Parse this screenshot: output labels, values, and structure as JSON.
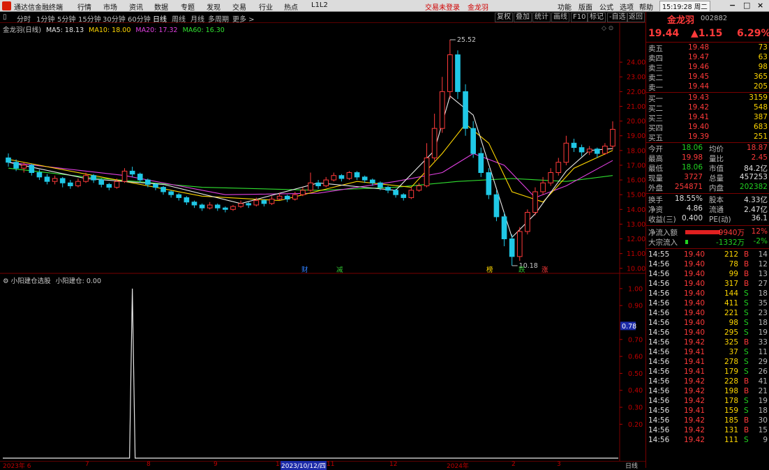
{
  "app": {
    "name": "通达信金融终端",
    "menu": [
      "行情",
      "市场",
      "资讯",
      "数据",
      "专题",
      "发现",
      "交易",
      "行业",
      "热点",
      "L1L2"
    ],
    "login_status": "交易未登录",
    "stock_tab": "金龙羽",
    "right_menu": [
      "功能",
      "版面",
      "公式",
      "选项",
      "帮助"
    ],
    "clock": "15:19:28",
    "weekday": "周二",
    "window_buttons": [
      "−",
      "□",
      "×"
    ]
  },
  "toolbar": {
    "periods": [
      "分时",
      "1分钟",
      "5分钟",
      "15分钟",
      "30分钟",
      "60分钟",
      "日线",
      "周线",
      "月线",
      "多周期",
      "更多 >"
    ],
    "active_period": "日线",
    "right_buttons": [
      "复权",
      "叠加",
      "统计",
      "画线",
      "F10",
      "标记",
      "-自选",
      "返回"
    ]
  },
  "main_legend": {
    "stock": "金龙羽(日线)",
    "ma5": "MA5: 18.13",
    "ma10": "MA10: 18.00",
    "ma20": "MA20: 17.32",
    "ma60": "MA60: 16.30"
  },
  "chart_data": {
    "type": "candlestick",
    "y_ticks": [
      "24.00",
      "23.00",
      "22.00",
      "21.00",
      "20.00",
      "19.00",
      "18.00",
      "17.00",
      "16.00",
      "15.00",
      "14.00",
      "13.00",
      "12.00",
      "11.00",
      "10.00"
    ],
    "ylim": [
      9.8,
      25.9
    ],
    "high_label": "25.52",
    "low_label": "10.18",
    "markers": [
      "财",
      "减",
      "榜",
      "跌",
      "涨"
    ],
    "candles": [
      [
        0,
        17.5,
        17.2,
        17.8,
        16.9
      ],
      [
        1,
        17.2,
        16.8,
        17.4,
        16.6
      ],
      [
        2,
        16.8,
        17.0,
        17.2,
        16.5
      ],
      [
        3,
        17.0,
        16.5,
        17.1,
        16.3
      ],
      [
        4,
        16.5,
        16.2,
        16.7,
        16.0
      ],
      [
        5,
        16.2,
        15.9,
        16.4,
        15.7
      ],
      [
        6,
        15.9,
        16.1,
        16.3,
        15.7
      ],
      [
        7,
        16.1,
        15.8,
        16.2,
        15.5
      ],
      [
        8,
        15.8,
        15.6,
        16.0,
        15.4
      ],
      [
        9,
        15.6,
        15.9,
        16.1,
        15.5
      ],
      [
        10,
        15.9,
        16.3,
        16.5,
        15.8
      ],
      [
        11,
        16.3,
        16.0,
        16.4,
        15.8
      ],
      [
        12,
        16.0,
        15.7,
        16.1,
        15.5
      ],
      [
        13,
        15.7,
        15.5,
        15.8,
        15.3
      ],
      [
        14,
        15.5,
        15.9,
        16.1,
        15.4
      ],
      [
        15,
        15.9,
        16.6,
        16.8,
        15.8
      ],
      [
        16,
        16.6,
        16.4,
        16.9,
        16.2
      ],
      [
        17,
        16.4,
        16.0,
        16.5,
        15.8
      ],
      [
        18,
        16.0,
        15.7,
        16.1,
        15.5
      ],
      [
        19,
        15.7,
        15.5,
        15.8,
        15.3
      ],
      [
        20,
        15.5,
        15.2,
        15.6,
        15.0
      ],
      [
        21,
        15.2,
        15.0,
        15.3,
        14.8
      ],
      [
        22,
        15.0,
        14.8,
        15.1,
        14.6
      ],
      [
        23,
        14.8,
        14.5,
        14.9,
        14.3
      ],
      [
        24,
        14.5,
        14.3,
        14.6,
        14.1
      ],
      [
        25,
        14.3,
        14.1,
        14.4,
        13.9
      ],
      [
        26,
        14.1,
        14.3,
        14.5,
        14.0
      ],
      [
        27,
        14.3,
        14.1,
        14.4,
        13.9
      ],
      [
        28,
        14.1,
        14.0,
        14.2,
        13.8
      ],
      [
        29,
        14.0,
        14.2,
        14.3,
        13.9
      ],
      [
        30,
        14.2,
        14.4,
        14.6,
        14.1
      ],
      [
        31,
        14.4,
        14.3,
        14.5,
        14.1
      ],
      [
        32,
        14.3,
        14.6,
        14.8,
        14.2
      ],
      [
        33,
        14.6,
        14.4,
        14.7,
        14.2
      ],
      [
        34,
        14.4,
        14.7,
        14.9,
        14.3
      ],
      [
        35,
        14.7,
        14.9,
        15.1,
        14.6
      ],
      [
        36,
        14.9,
        14.7,
        15.0,
        14.5
      ],
      [
        37,
        14.7,
        15.0,
        15.2,
        14.6
      ],
      [
        38,
        15.0,
        15.3,
        15.5,
        14.9
      ],
      [
        39,
        15.3,
        15.8,
        16.5,
        15.2
      ],
      [
        40,
        15.8,
        15.6,
        16.0,
        15.4
      ],
      [
        41,
        15.6,
        16.0,
        16.2,
        15.5
      ],
      [
        42,
        16.0,
        16.3,
        16.5,
        15.9
      ],
      [
        43,
        16.3,
        16.1,
        16.4,
        15.9
      ],
      [
        44,
        16.1,
        16.5,
        16.6,
        16.0
      ],
      [
        45,
        16.5,
        16.2,
        16.6,
        16.0
      ],
      [
        46,
        16.2,
        16.0,
        16.3,
        15.8
      ],
      [
        47,
        16.0,
        15.8,
        16.1,
        15.6
      ],
      [
        48,
        15.8,
        15.5,
        15.9,
        15.3
      ],
      [
        49,
        15.5,
        15.3,
        15.6,
        15.1
      ],
      [
        50,
        15.3,
        15.0,
        15.4,
        14.8
      ],
      [
        51,
        15.0,
        14.8,
        15.1,
        14.6
      ],
      [
        52,
        14.8,
        15.3,
        15.5,
        14.7
      ],
      [
        53,
        15.3,
        15.6,
        15.8,
        15.2
      ],
      [
        54,
        15.6,
        17.5,
        18.5,
        15.5
      ],
      [
        55,
        17.5,
        19.5,
        20.5,
        17.3
      ],
      [
        56,
        19.5,
        22.0,
        23.0,
        19.2
      ],
      [
        57,
        22.0,
        24.5,
        25.52,
        21.5
      ],
      [
        58,
        24.5,
        22.0,
        24.8,
        21.5
      ],
      [
        59,
        22.0,
        19.5,
        22.5,
        19.0
      ],
      [
        60,
        19.5,
        17.8,
        20.0,
        17.5
      ],
      [
        61,
        17.8,
        16.5,
        18.2,
        16.2
      ],
      [
        62,
        16.5,
        15.0,
        16.8,
        14.7
      ],
      [
        63,
        15.0,
        13.5,
        15.3,
        13.2
      ],
      [
        64,
        13.5,
        12.0,
        13.8,
        11.5
      ],
      [
        65,
        12.0,
        10.8,
        12.3,
        10.18
      ],
      [
        66,
        10.8,
        12.5,
        12.8,
        10.5
      ],
      [
        67,
        12.5,
        13.8,
        14.0,
        12.3
      ],
      [
        68,
        13.8,
        15.2,
        15.5,
        13.6
      ],
      [
        69,
        15.2,
        15.8,
        16.2,
        15.0
      ],
      [
        70,
        15.8,
        16.5,
        16.8,
        15.6
      ],
      [
        71,
        16.5,
        17.2,
        17.5,
        16.3
      ],
      [
        72,
        17.2,
        18.5,
        19.0,
        17.0
      ],
      [
        73,
        18.5,
        18.2,
        18.8,
        17.9
      ],
      [
        74,
        18.2,
        17.9,
        18.4,
        17.6
      ],
      [
        75,
        17.9,
        18.1,
        18.3,
        17.7
      ],
      [
        76,
        18.1,
        17.8,
        18.2,
        17.5
      ],
      [
        77,
        17.8,
        18.3,
        18.5,
        17.7
      ],
      [
        78,
        18.3,
        19.44,
        19.98,
        18.06
      ]
    ],
    "ma5": [
      [
        0,
        17.2
      ],
      [
        10,
        16.1
      ],
      [
        20,
        15.7
      ],
      [
        30,
        14.4
      ],
      [
        40,
        15.8
      ],
      [
        50,
        15.3
      ],
      [
        55,
        18.0
      ],
      [
        57,
        21.7
      ],
      [
        60,
        20.4
      ],
      [
        63,
        15.4
      ],
      [
        65,
        12.1
      ],
      [
        68,
        13.7
      ],
      [
        72,
        16.6
      ],
      [
        75,
        18.0
      ],
      [
        78,
        18.13
      ]
    ],
    "ma10": [
      [
        0,
        17.4
      ],
      [
        12,
        16.2
      ],
      [
        25,
        14.9
      ],
      [
        35,
        14.6
      ],
      [
        45,
        15.9
      ],
      [
        52,
        15.5
      ],
      [
        56,
        17.8
      ],
      [
        59,
        19.8
      ],
      [
        62,
        18.5
      ],
      [
        65,
        15.2
      ],
      [
        69,
        14.5
      ],
      [
        73,
        16.8
      ],
      [
        78,
        18.0
      ]
    ],
    "ma20": [
      [
        0,
        17.2
      ],
      [
        15,
        16.3
      ],
      [
        28,
        15.0
      ],
      [
        40,
        15.1
      ],
      [
        50,
        15.9
      ],
      [
        56,
        16.5
      ],
      [
        60,
        17.8
      ],
      [
        64,
        17.0
      ],
      [
        68,
        14.8
      ],
      [
        72,
        15.6
      ],
      [
        78,
        17.32
      ]
    ],
    "ma60": [
      [
        0,
        16.8
      ],
      [
        10,
        16.2
      ],
      [
        25,
        15.5
      ],
      [
        40,
        15.3
      ],
      [
        50,
        15.5
      ],
      [
        58,
        15.9
      ],
      [
        65,
        16.1
      ],
      [
        72,
        15.9
      ],
      [
        78,
        16.3
      ]
    ]
  },
  "sub_legend": {
    "title": "小阳建仓选股",
    "value": "小阳建仓: 0.00"
  },
  "sub_axis": [
    "1.00",
    "0.90",
    "0.70",
    "0.60",
    "0.50",
    "0.40",
    "0.30",
    "0.20"
  ],
  "sub_highlight": "0.78",
  "sub_chart": {
    "spike_index": 16,
    "spike_value": 1.0
  },
  "dates": [
    "2023年 6",
    "7",
    "8",
    "9",
    "10",
    "2023/10/12/四",
    "11",
    "12",
    "2024年",
    "2",
    "3"
  ],
  "bottom_tab": "日线",
  "quote": {
    "name": "金龙羽",
    "code": "002882",
    "price": "19.44",
    "change": "▲1.15",
    "pct": "6.29%",
    "asks": [
      {
        "l": "卖五",
        "p": "19.48",
        "v": "73"
      },
      {
        "l": "卖四",
        "p": "19.47",
        "v": "63"
      },
      {
        "l": "卖三",
        "p": "19.46",
        "v": "98"
      },
      {
        "l": "卖二",
        "p": "19.45",
        "v": "365"
      },
      {
        "l": "卖一",
        "p": "19.44",
        "v": "205"
      }
    ],
    "bids": [
      {
        "l": "买一",
        "p": "19.43",
        "v": "3159"
      },
      {
        "l": "买二",
        "p": "19.42",
        "v": "548"
      },
      {
        "l": "买三",
        "p": "19.41",
        "v": "387"
      },
      {
        "l": "买四",
        "p": "19.40",
        "v": "683"
      },
      {
        "l": "买五",
        "p": "19.39",
        "v": "251"
      }
    ],
    "stats": [
      {
        "l1": "今开",
        "v1": "18.06",
        "c1": "dn",
        "l2": "均价",
        "v2": "18.87",
        "c2": "up"
      },
      {
        "l1": "最高",
        "v1": "19.98",
        "c1": "up",
        "l2": "量比",
        "v2": "2.45",
        "c2": "up"
      },
      {
        "l1": "最低",
        "v1": "18.06",
        "c1": "dn",
        "l2": "市值",
        "v2": "84.2亿",
        "c2": "wt"
      },
      {
        "l1": "现量",
        "v1": "3727",
        "c1": "up",
        "l2": "总量",
        "v2": "457253",
        "c2": "wt"
      },
      {
        "l1": "外盘",
        "v1": "254871",
        "c1": "up",
        "l2": "内盘",
        "v2": "202382",
        "c2": "dn"
      }
    ],
    "stats2": [
      {
        "l1": "换手",
        "v1": "18.55%",
        "l2": "股本",
        "v2": "4.33亿"
      },
      {
        "l1": "净资",
        "v1": "4.86",
        "l2": "流通",
        "v2": "2.47亿"
      },
      {
        "l1": "收益(三)",
        "v1": "0.400",
        "l2": "PE(动)",
        "v2": "36.1"
      }
    ],
    "inflow": {
      "label": "净流入额",
      "value": "9940万",
      "pct": "12%"
    },
    "block": {
      "label": "大宗流入",
      "value": "-1332万",
      "pct": "-2%"
    },
    "ticks": [
      [
        "14:55",
        "19.40",
        "212",
        "B",
        "14"
      ],
      [
        "14:56",
        "19.40",
        "78",
        "B",
        "12"
      ],
      [
        "14:56",
        "19.40",
        "99",
        "B",
        "13"
      ],
      [
        "14:56",
        "19.40",
        "317",
        "B",
        "27"
      ],
      [
        "14:56",
        "19.40",
        "144",
        "S",
        "18"
      ],
      [
        "14:56",
        "19.40",
        "411",
        "S",
        "35"
      ],
      [
        "14:56",
        "19.40",
        "221",
        "S",
        "23"
      ],
      [
        "14:56",
        "19.40",
        "98",
        "S",
        "18"
      ],
      [
        "14:56",
        "19.40",
        "295",
        "S",
        "19"
      ],
      [
        "14:56",
        "19.42",
        "325",
        "B",
        "33"
      ],
      [
        "14:56",
        "19.41",
        "37",
        "S",
        "11"
      ],
      [
        "14:56",
        "19.41",
        "278",
        "S",
        "29"
      ],
      [
        "14:56",
        "19.41",
        "179",
        "S",
        "26"
      ],
      [
        "14:56",
        "19.42",
        "228",
        "B",
        "41"
      ],
      [
        "14:56",
        "19.42",
        "198",
        "B",
        "21"
      ],
      [
        "14:56",
        "19.42",
        "178",
        "S",
        "19"
      ],
      [
        "14:56",
        "19.41",
        "159",
        "S",
        "18"
      ],
      [
        "14:56",
        "19.42",
        "185",
        "B",
        "30"
      ],
      [
        "14:56",
        "19.42",
        "131",
        "B",
        "15"
      ],
      [
        "14:56",
        "19.42",
        "111",
        "S",
        "9"
      ]
    ]
  }
}
